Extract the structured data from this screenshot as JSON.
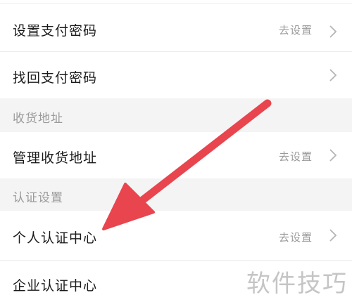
{
  "payment": {
    "set_password": {
      "label": "设置支付密码",
      "value": "去设置"
    },
    "recover_password": {
      "label": "找回支付密码"
    }
  },
  "shipping": {
    "section_title": "收货地址",
    "manage_address": {
      "label": "管理收货地址",
      "value": "去设置"
    }
  },
  "verification": {
    "section_title": "认证设置",
    "personal": {
      "label": "个人认证中心",
      "value": "去设置"
    },
    "enterprise": {
      "label": "企业认证中心"
    }
  },
  "annotation": {
    "arrow_color": "#e8454f"
  },
  "watermark": {
    "text": "软件技巧"
  }
}
